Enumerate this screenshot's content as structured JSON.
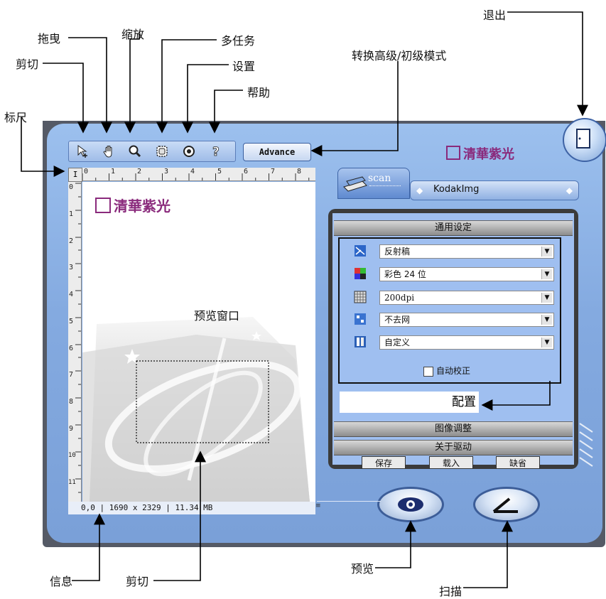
{
  "callouts": {
    "exit": "退出",
    "drag": "拖曳",
    "zoom": "缩放",
    "multitask": "多任务",
    "crop_top": "剪切",
    "settings": "设置",
    "mode_switch": "转换高级/初级模式",
    "help": "帮助",
    "ruler": "标尺",
    "preview_window": "预览窗口",
    "config": "配置",
    "info": "信息",
    "crop_bottom": "剪切",
    "preview": "预览",
    "scan": "扫描"
  },
  "toolbar": {
    "advance_label": "Advance",
    "icons": [
      "crop-icon",
      "hand-icon",
      "magnifier-icon",
      "multitask-icon",
      "gear-icon",
      "help-icon"
    ]
  },
  "brand": {
    "text": "清華紫光"
  },
  "ruler": {
    "corner": "I",
    "h_ticks": [
      "0",
      "1",
      "2",
      "3",
      "4",
      "5",
      "6",
      "7",
      "8"
    ],
    "v_ticks": [
      "0",
      "1",
      "2",
      "3",
      "4",
      "5",
      "6",
      "7",
      "8",
      "9",
      "10",
      "11"
    ]
  },
  "info_bar": {
    "text": "0,0 | 1690 x 2329 | 11.34 MB"
  },
  "tabs": {
    "scan": "scan",
    "driver": "KodakImg"
  },
  "settings": {
    "general_header": "通用设定",
    "rows": [
      {
        "icon": "document-type-icon",
        "value": "反射稿"
      },
      {
        "icon": "color-mode-icon",
        "value": "彩色 24 位"
      },
      {
        "icon": "resolution-icon",
        "value": "200dpi"
      },
      {
        "icon": "descreen-icon",
        "value": "不去网"
      },
      {
        "icon": "size-icon",
        "value": "自定义"
      }
    ],
    "auto_correct": "自动校正",
    "image_adjust_header": "图像调整",
    "about_driver_header": "关于驱动",
    "buttons": {
      "save": "保存",
      "load": "载入",
      "default": "缺省"
    }
  },
  "colors": {
    "panel": "#86acE2",
    "brand": "#8a2a7c",
    "frame": "#555a66"
  }
}
